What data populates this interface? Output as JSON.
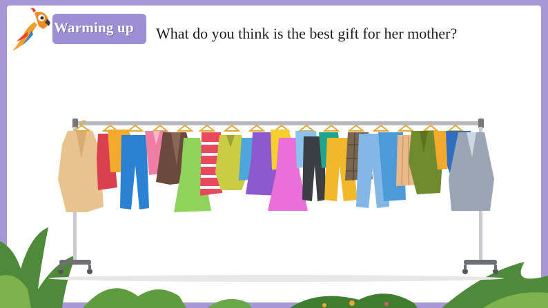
{
  "header": {
    "badge_label": "Warming up",
    "question": "What do you think is the best gift for her mother?"
  },
  "icons": [
    "parrot-icon",
    "clothes-rack-illustration",
    "leaf-decoration"
  ],
  "colors": {
    "frame": "#a797d8",
    "badge": "#9d8fd3",
    "panel": "#ffffff",
    "text": "#1b1b1b"
  }
}
